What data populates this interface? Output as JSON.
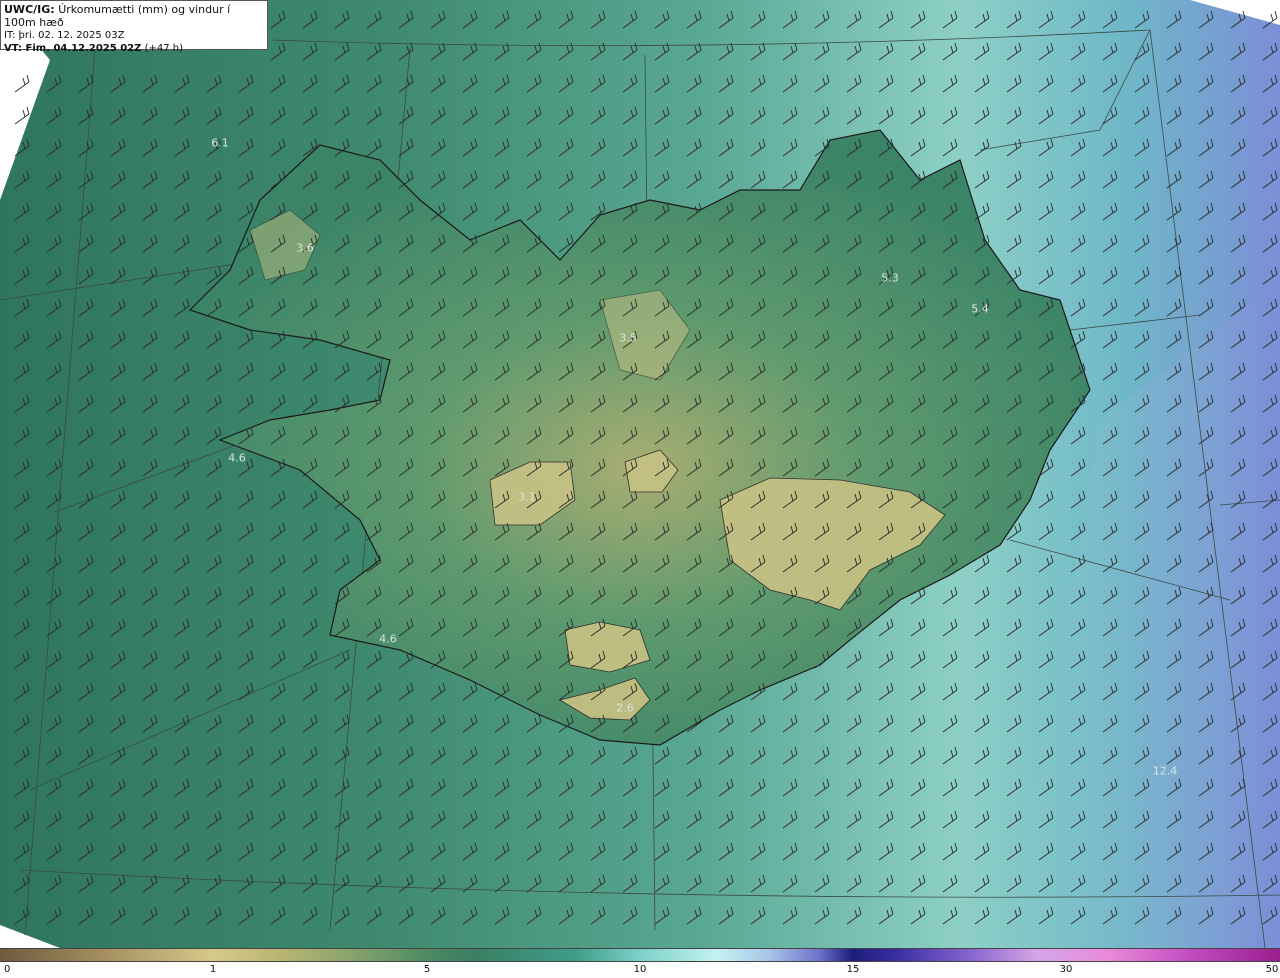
{
  "header": {
    "product": "UWC/IG:",
    "title": "Úrkomumætti (mm) og vindur í 100m hæð",
    "init_time": "IT: þri. 02. 12. 2025 03Z",
    "valid_prefix": "VT: Fim. 04.12.2025 02Z",
    "valid_suffix": "(+47 h)"
  },
  "legend": {
    "ticks": [
      "0",
      "1",
      "5",
      "10",
      "15",
      "30",
      "50"
    ]
  },
  "map_values": [
    "6.1",
    "3.6",
    "5.3",
    "5.4",
    "3.5",
    "4.6",
    "3.1",
    "4.6",
    "2.6",
    "12.4"
  ],
  "colors": {
    "land_low": "#3f8a6e",
    "land_high": "#b8b77a",
    "sea": "#8ed0c6",
    "heavy": "#6d73cc"
  }
}
